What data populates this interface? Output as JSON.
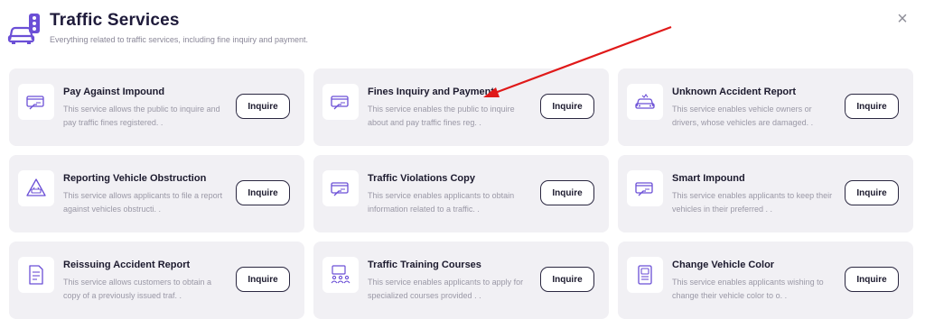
{
  "header": {
    "title": "Traffic Services",
    "subtitle": "Everything related to traffic services, including fine inquiry and payment.",
    "icon": "car-traffic-light-icon",
    "close_label": "×"
  },
  "accent_color": "#6b4fd6",
  "arrow_color": "#e01919",
  "cards": [
    {
      "title": "Pay Against Impound",
      "desc": "This service allows the public to inquire and pay traffic fines registered. .",
      "button": "Inquire",
      "icon": "card-payment-icon"
    },
    {
      "title": "Fines Inquiry and Payment",
      "desc": "This service enables the public to inquire about and pay traffic fines reg. .",
      "button": "Inquire",
      "icon": "card-payment-icon"
    },
    {
      "title": "Unknown Accident Report",
      "desc": "This service enables vehicle owners or drivers, whose vehicles are damaged. .",
      "button": "Inquire",
      "icon": "car-accident-icon"
    },
    {
      "title": "Reporting Vehicle Obstruction",
      "desc": "This service allows applicants to file a report against vehicles obstructi. .",
      "button": "Inquire",
      "icon": "warning-vehicle-icon"
    },
    {
      "title": "Traffic Violations Copy",
      "desc": "This service enables applicants to obtain information related to a traffic. .",
      "button": "Inquire",
      "icon": "card-payment-icon"
    },
    {
      "title": "Smart Impound",
      "desc": "This service enables applicants to keep their vehicles in their preferred . .",
      "button": "Inquire",
      "icon": "card-payment-icon"
    },
    {
      "title": "Reissuing Accident Report",
      "desc": "This service allows customers to obtain a copy of a previously issued traf. .",
      "button": "Inquire",
      "icon": "document-icon"
    },
    {
      "title": "Traffic Training Courses",
      "desc": "This service enables applicants to apply for specialized courses provided . .",
      "button": "Inquire",
      "icon": "training-class-icon"
    },
    {
      "title": "Change Vehicle Color",
      "desc": "This service enables applicants wishing to change their vehicle color to o. .",
      "button": "Inquire",
      "icon": "vehicle-document-icon"
    }
  ]
}
